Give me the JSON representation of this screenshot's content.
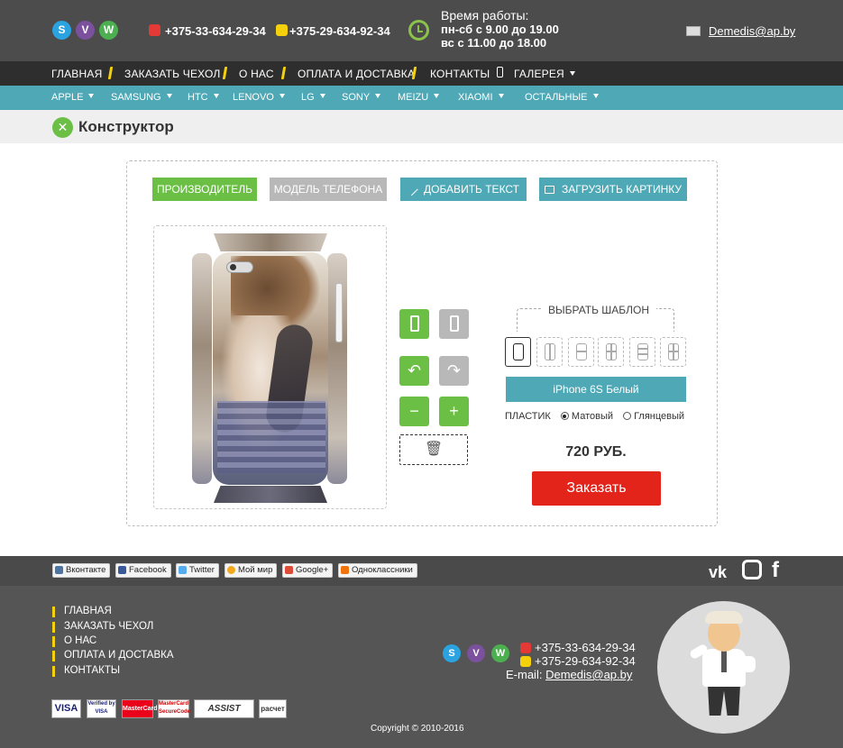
{
  "header": {
    "phone_1": "+375-33-634-29-34",
    "phone_2": "+375-29-634-92-34",
    "hours_title": "Время работы:",
    "hours_weekday": "пн-сб с 9.00 до 19.00",
    "hours_sunday": "вс с 11.00 до 18.00",
    "email": "Demedis@ap.by",
    "messengers": [
      "skype-icon",
      "viber-icon",
      "whatsapp-icon"
    ]
  },
  "main_nav": {
    "items": [
      "ГЛАВНАЯ",
      "ЗАКАЗАТЬ ЧЕХОЛ",
      "О НАС",
      "ОПЛАТА И ДОСТАВКА",
      "КОНТАКТЫ",
      "ГАЛЕРЕЯ"
    ]
  },
  "brand_nav": {
    "items": [
      "APPLE",
      "SAMSUNG",
      "HTC",
      "LENOVO",
      "LG",
      "SONY",
      "MEIZU",
      "XIAOMI",
      "ОСТАЛЬНЫЕ"
    ]
  },
  "page": {
    "title": "Конструктор"
  },
  "constructor": {
    "buttons": {
      "manufacturer": "ПРОИЗВОДИТЕЛЬ",
      "phone_model": "МОДЕЛЬ ТЕЛЕФОНА",
      "add_text": "ДОБАВИТЬ ТЕКСТ",
      "upload_image": "ЗАГРУЗИТЬ КАРТИНКУ"
    },
    "template_title": "ВЫБРАТЬ ШАБЛОН",
    "selected_model": "iPhone 6S Белый",
    "material_label": "ПЛАСТИК",
    "material_options": [
      "Матовый",
      "Глянцевый"
    ],
    "material_selected": "Матовый",
    "price": "720 РУБ.",
    "order_button": "Заказать"
  },
  "footer": {
    "share": [
      "Вконтакте",
      "Facebook",
      "Twitter",
      "Мой мир",
      "Google+",
      "Одноклассники"
    ],
    "social_icons": [
      "vk-icon",
      "instagram-icon",
      "facebook-icon"
    ],
    "nav": [
      "ГЛАВНАЯ",
      "ЗАКАЗАТЬ ЧЕХОЛ",
      "О НАС",
      "ОПЛАТА И ДОСТАВКА",
      "КОНТАКТЫ"
    ],
    "phone_1": "+375-33-634-29-34",
    "phone_2": "+375-29-634-92-34",
    "email_label": "E-mail:",
    "email": "Demedis@ap.by",
    "payments": [
      "VISA",
      "Verified by VISA",
      "MasterCard",
      "MasterCard SecureCode",
      "ASSIST",
      "расчет"
    ],
    "copyright": "Copyright  ©  2010-2016"
  },
  "colors": {
    "header_bg": "#4c4c4c",
    "nav_bg": "#2e2e2e",
    "brand_bg": "#4fa8b5",
    "accent_green": "#6cbf45",
    "order_red": "#e2241b",
    "nav_separator": "#f5d10c"
  }
}
